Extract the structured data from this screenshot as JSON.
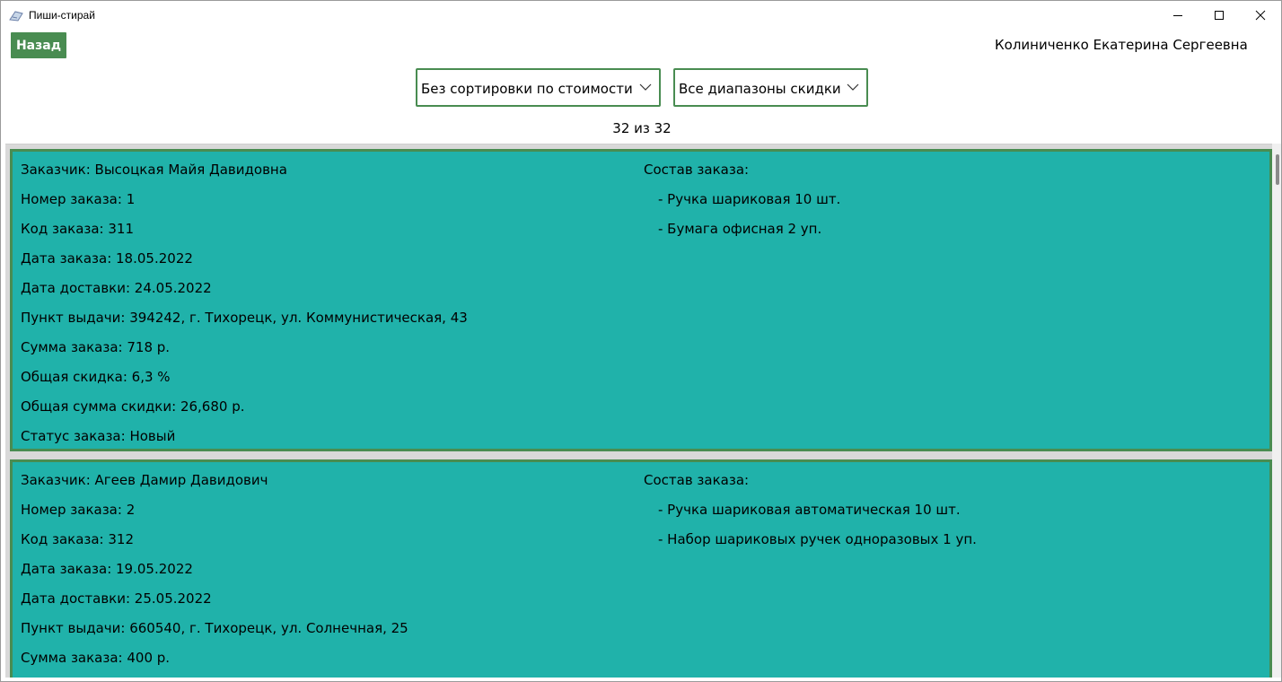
{
  "window": {
    "title": "Пиши-стирай",
    "icons": {
      "app": "notebook-icon",
      "minimize": "minimize-icon",
      "maximize": "maximize-icon",
      "close": "close-icon"
    }
  },
  "header": {
    "back_label": "Назад",
    "user_name": "Колиниченко Екатерина Сергеевна"
  },
  "filters": {
    "sort_selected": "Без сортировки по стоимости",
    "discount_selected": "Все диапазоны скидки"
  },
  "counter": "32 из 32",
  "colors": {
    "accent": "#498c51",
    "card_bg": "#20b2aa",
    "list_bg": "#d9d9d9"
  },
  "orders": [
    {
      "customer": "Заказчик: Высоцкая Майя Давидовна",
      "number": "Номер заказа: 1",
      "code": "Код заказа: 311",
      "order_date": "Дата заказа: 18.05.2022",
      "delivery_date": "Дата доставки: 24.05.2022",
      "pickup": "Пункт выдачи: 394242, г. Тихорецк, ул. Коммунистическая, 43",
      "total": "Сумма заказа: 718 р.",
      "discount": "Общая скидка: 6,3 %",
      "discount_sum": "Общая сумма скидки: 26,680 р.",
      "status": "Статус заказа: Новый",
      "composition_label": "Состав заказа:",
      "items": [
        "- Ручка шариковая 10 шт.",
        "- Бумага офисная 2 уп."
      ]
    },
    {
      "customer": "Заказчик: Агеев Дамир Давидович",
      "number": "Номер заказа: 2",
      "code": "Код заказа: 312",
      "order_date": "Дата заказа: 19.05.2022",
      "delivery_date": "Дата доставки: 25.05.2022",
      "pickup": "Пункт выдачи: 660540, г. Тихорецк, ул. Солнечная, 25",
      "total": "Сумма заказа: 400 р.",
      "composition_label": "Состав заказа:",
      "items": [
        "- Ручка шариковая автоматическая 10 шт.",
        "- Набор шариковых ручек одноразовых 1 уп."
      ]
    }
  ]
}
